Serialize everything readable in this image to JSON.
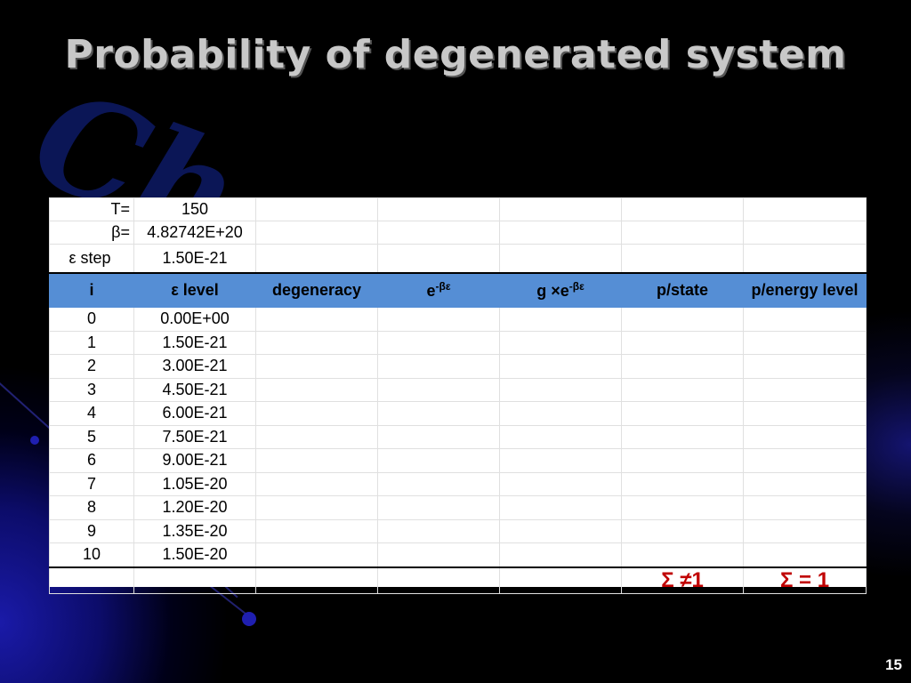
{
  "slide": {
    "title": "Probability of degenerated system",
    "page_number": "15"
  },
  "params": [
    {
      "label": "T=",
      "value": "150"
    },
    {
      "label": "β=",
      "value": "4.82742E+20"
    },
    {
      "label": "ε step",
      "value": "1.50E-21"
    }
  ],
  "headers": [
    "i",
    "ε level",
    "degeneracy",
    "e",
    "g ×e",
    "p/state",
    "p/energy level"
  ],
  "header_superscripts": {
    "e": "-βε",
    "g": "-βε"
  },
  "rows": [
    {
      "i": "0",
      "level": "0.00E+00"
    },
    {
      "i": "1",
      "level": "1.50E-21"
    },
    {
      "i": "2",
      "level": "3.00E-21"
    },
    {
      "i": "3",
      "level": "4.50E-21"
    },
    {
      "i": "4",
      "level": "6.00E-21"
    },
    {
      "i": "5",
      "level": "7.50E-21"
    },
    {
      "i": "6",
      "level": "9.00E-21"
    },
    {
      "i": "7",
      "level": "1.05E-20"
    },
    {
      "i": "8",
      "level": "1.20E-20"
    },
    {
      "i": "9",
      "level": "1.35E-20"
    },
    {
      "i": "10",
      "level": "1.50E-20"
    }
  ],
  "sums": {
    "p_state": "Σ ≠1",
    "p_energy": "Σ = 1"
  },
  "colors": {
    "header_bg": "#558ed5",
    "sum_text": "#c00000",
    "title": "#c8c8c8"
  }
}
